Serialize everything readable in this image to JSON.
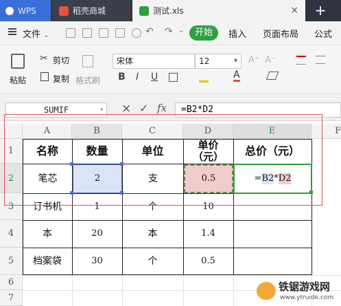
{
  "tabs": {
    "wps": "WPS",
    "store": "稻壳商城",
    "file": "测试.xls",
    "close": "×",
    "add": "+"
  },
  "menu": {
    "file": "文件",
    "start": "开始",
    "insert": "插入",
    "layout": "页面布局",
    "formula": "公式"
  },
  "ribbon": {
    "paste": "粘贴",
    "cut": "剪切",
    "copy": "复制",
    "format_painter": "格式刷",
    "font_name": "宋体",
    "font_size": "12",
    "bold": "B",
    "italic": "I",
    "underline": "U"
  },
  "formula_bar": {
    "name_box": "SUMIF",
    "cancel": "×",
    "confirm": "✓",
    "fx": "fx",
    "formula": "=B2*D2"
  },
  "columns": [
    "A",
    "B",
    "C",
    "D",
    "E",
    "F"
  ],
  "rows": [
    "1",
    "2",
    "3",
    "4",
    "5",
    "6",
    "7"
  ],
  "table": {
    "headers": [
      "名称",
      "数量",
      "单位",
      "单价\n（元）",
      "总价（元）"
    ],
    "data": [
      [
        "笔芯",
        "2",
        "支",
        "0.5"
      ],
      [
        "订书机",
        "1",
        "个",
        "10"
      ],
      [
        "本",
        "20",
        "本",
        "1.4"
      ],
      [
        "档案袋",
        "30",
        "个",
        "0.5"
      ]
    ],
    "edit_formula": {
      "eq": "=",
      "ref1": "B2",
      "op": "*",
      "ref2": "D2"
    }
  },
  "watermark": {
    "brand": "铁锯游戏网",
    "url": "www.ytruide.com"
  },
  "colors": {
    "wps_blue": "#3b6fd8",
    "start_green": "#2ea043",
    "highlight_red": "#d9534f",
    "ref_blue_fill": "#dbe3f8",
    "ref_red_fill": "#f2cccc"
  }
}
